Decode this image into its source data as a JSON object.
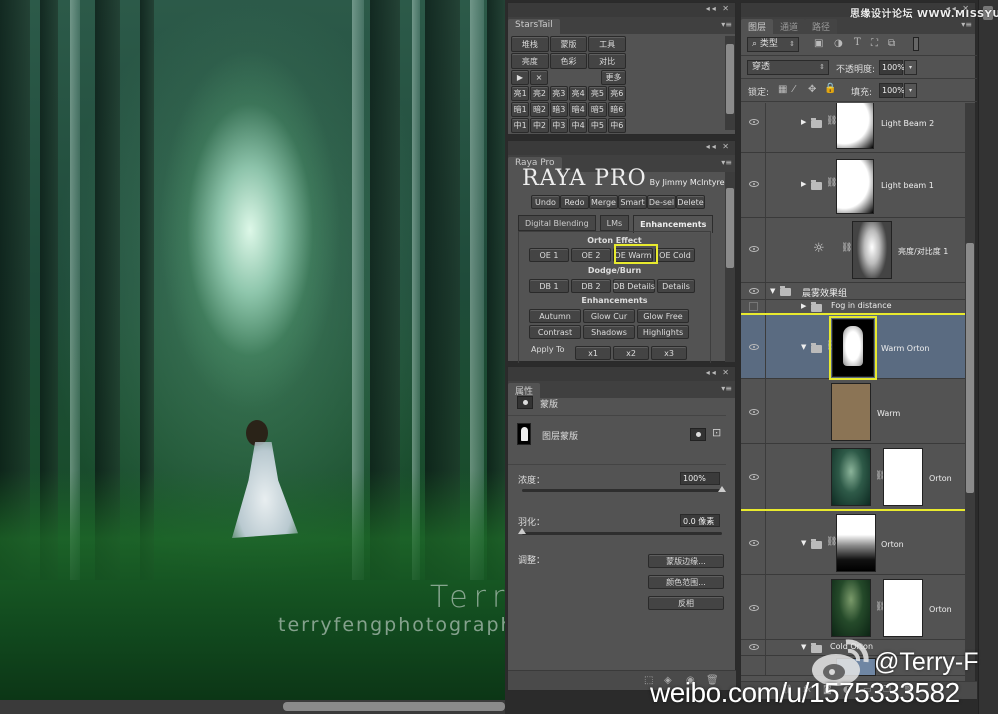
{
  "photo": {
    "watermark_name": "Terry F",
    "watermark_url": "terryfengphotography.lofter.com"
  },
  "starstail": {
    "tab": "StarsTail",
    "top_buttons": [
      "堆栈",
      "蒙版",
      "工具"
    ],
    "second_buttons": [
      "亮度",
      "色彩",
      "对比"
    ],
    "play_icon": "▶",
    "close_icon": "×",
    "more": "更多",
    "grid": [
      [
        "亮1",
        "亮2",
        "亮3",
        "亮4",
        "亮5",
        "亮6"
      ],
      [
        "暗1",
        "暗2",
        "暗3",
        "暗4",
        "暗5",
        "暗6"
      ],
      [
        "中1",
        "中2",
        "中3",
        "中4",
        "中5",
        "中6"
      ]
    ]
  },
  "raya": {
    "tab": "Raya Pro",
    "title": "RAYA PRO",
    "byline": "By Jimmy McIntyre",
    "toolbar": [
      "Undo",
      "Redo",
      "Merge",
      "Smart",
      "De-sel",
      "Delete"
    ],
    "tabs": [
      "Digital Blending",
      "LMs",
      "Enhancements"
    ],
    "active_tab": "Enhancements",
    "sections": {
      "orton": {
        "title": "Orton Effect",
        "buttons": [
          "OE 1",
          "OE 2",
          "OE Warm",
          "OE Cold"
        ],
        "highlighted": "OE Warm"
      },
      "dodge": {
        "title": "Dodge/Burn",
        "buttons": [
          "DB 1",
          "DB 2",
          "DB Details",
          "Details"
        ]
      },
      "enh": {
        "title": "Enhancements",
        "row1": [
          "Autumn",
          "Glow Cur",
          "Glow Free"
        ],
        "row2": [
          "Contrast",
          "Shadows",
          "Highlights"
        ]
      },
      "apply": {
        "label": "Apply To",
        "buttons": [
          "x1",
          "x2",
          "x3"
        ]
      }
    }
  },
  "properties": {
    "tab": "属性",
    "type_label": "蒙版",
    "mask_label": "图层蒙版",
    "density_label": "浓度：",
    "density_value": "100%",
    "density_fraction": 1.0,
    "feather_label": "羽化：",
    "feather_value": "0.0 像素",
    "feather_fraction": 0.0,
    "adjust_label": "调整：",
    "buttons": [
      "蒙版边缘...",
      "颜色范围...",
      "反相"
    ]
  },
  "layers": {
    "tabs": [
      "图层",
      "通道",
      "路径"
    ],
    "active_tab": "图层",
    "filter_kind": "类型",
    "blend_mode": "穿透",
    "opacity_label": "不透明度:",
    "opacity_value": "100%",
    "lock_label": "锁定:",
    "fill_label": "填充:",
    "fill_value": "100%",
    "items": [
      {
        "name": "Light Beam 2",
        "type": "group",
        "visible": true,
        "expanded": false
      },
      {
        "name": "Light beam 1",
        "type": "group",
        "visible": true,
        "expanded": false
      },
      {
        "name": "亮度/对比度 1",
        "type": "adjustment",
        "visible": true
      },
      {
        "name": "晨雾效果组",
        "type": "group",
        "visible": true,
        "expanded": true
      },
      {
        "name": "Fog in distance",
        "type": "group",
        "visible": false,
        "expanded": false
      },
      {
        "name": "Warm Orton",
        "type": "group",
        "visible": true,
        "expanded": true,
        "selected": true
      },
      {
        "name": "Warm",
        "type": "fill",
        "visible": true,
        "color": "#8b7455"
      },
      {
        "name": "Orton",
        "type": "layer",
        "visible": true
      },
      {
        "name": "Orton",
        "type": "group",
        "visible": true,
        "expanded": true
      },
      {
        "name": "Orton",
        "type": "layer",
        "visible": true
      },
      {
        "name": "Cold Orton",
        "type": "group",
        "visible": true,
        "expanded": true
      }
    ]
  },
  "overlays": {
    "site_watermark": "思缘设计论坛 WWW.MISSYUAN.COM",
    "weibo_handle": "@Terry-F",
    "weibo_url": "weibo.com/u/1575333582"
  },
  "colors": {
    "highlight": "#e8ea2e",
    "selected_layer": "#5a6b81",
    "panel_bg": "#535353"
  }
}
